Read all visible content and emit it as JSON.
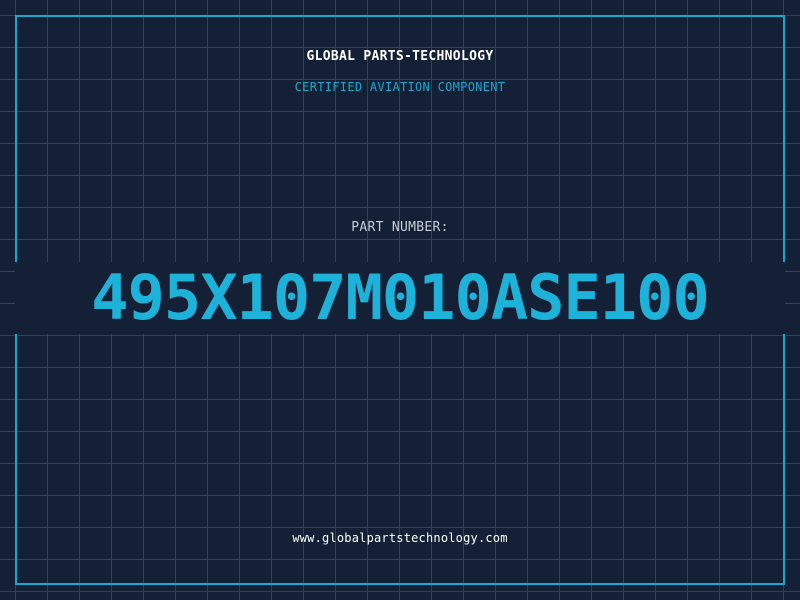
{
  "header": {
    "company": "GLOBAL PARTS-TECHNOLOGY",
    "subtitle": "CERTIFIED AVIATION COMPONENT"
  },
  "part": {
    "label": "PART NUMBER:",
    "number": "495X107M010ASE100"
  },
  "footer": {
    "website": "www.globalpartstechnology.com"
  },
  "colors": {
    "background": "#132036",
    "grid": "#1d4a62",
    "accent": "#1aa6cf",
    "part_number": "#1cb2d9",
    "label": "#c9ced6",
    "text": "#ffffff"
  }
}
